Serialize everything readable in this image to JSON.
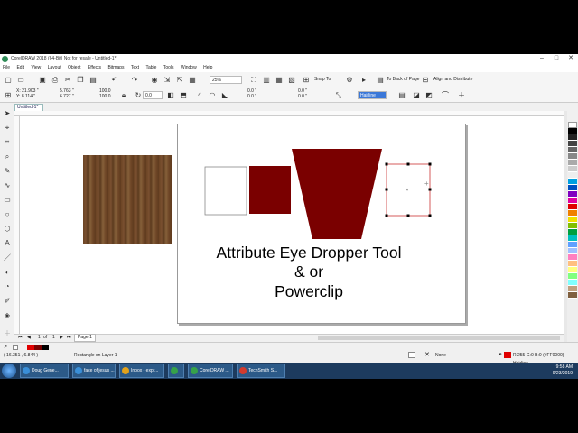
{
  "window": {
    "title": "CorelDRAW 2018 (64-Bit) Not for resale - Untitled-1*"
  },
  "menu": [
    "File",
    "Edit",
    "View",
    "Layout",
    "Object",
    "Effects",
    "Bitmaps",
    "Text",
    "Table",
    "Tools",
    "Window",
    "Help"
  ],
  "toolbar": {
    "zoom": "25%",
    "snap_to": "Snap To",
    "to_back": "To Back of Page",
    "align": "Align and Distribute"
  },
  "propbar": {
    "x": "X: 21.903 \"",
    "y": "Y: 8.114 \"",
    "w": "5.763 \"",
    "h": "6.727 \"",
    "sx": "100.0",
    "sy": "100.0",
    "angle": "0.0",
    "corner1": "0.0 \"",
    "corner2": "0.0 \"",
    "r1": "0.0 \"",
    "r2": "0.0 \"",
    "outline": "Hairline"
  },
  "doc_tab": "Untitled-1*",
  "page": {
    "text_line1": "Attribute Eye Dropper Tool",
    "text_line2": "& or",
    "text_line3": "Powerclip"
  },
  "colors": {
    "dark_red": "#7a0000",
    "selection": "#cc3333"
  },
  "pagenav": {
    "pos": "1",
    "of": "of",
    "total": "1",
    "page_tab": "Page 1"
  },
  "status": {
    "coords": "( 16.351 , 6.844 )",
    "object": "Rectangle on Layer 1",
    "fill": "None",
    "outline_info": "R:255 G:0 B:0 (#FF0000)  Hairline"
  },
  "taskbar": {
    "tasks": [
      {
        "label": "Doug Gene...",
        "color": "#3a8fd8"
      },
      {
        "label": "face of jesus ...",
        "color": "#3a8fd8"
      },
      {
        "label": "Inbox - expr...",
        "color": "#e2a21b"
      },
      {
        "label": "",
        "color": "#36a24a"
      },
      {
        "label": "CorelDRAW ...",
        "color": "#36a24a"
      },
      {
        "label": "TechSmith S...",
        "color": "#d23b2e"
      }
    ],
    "time": "9:58 AM",
    "date": "9/23/2019"
  }
}
